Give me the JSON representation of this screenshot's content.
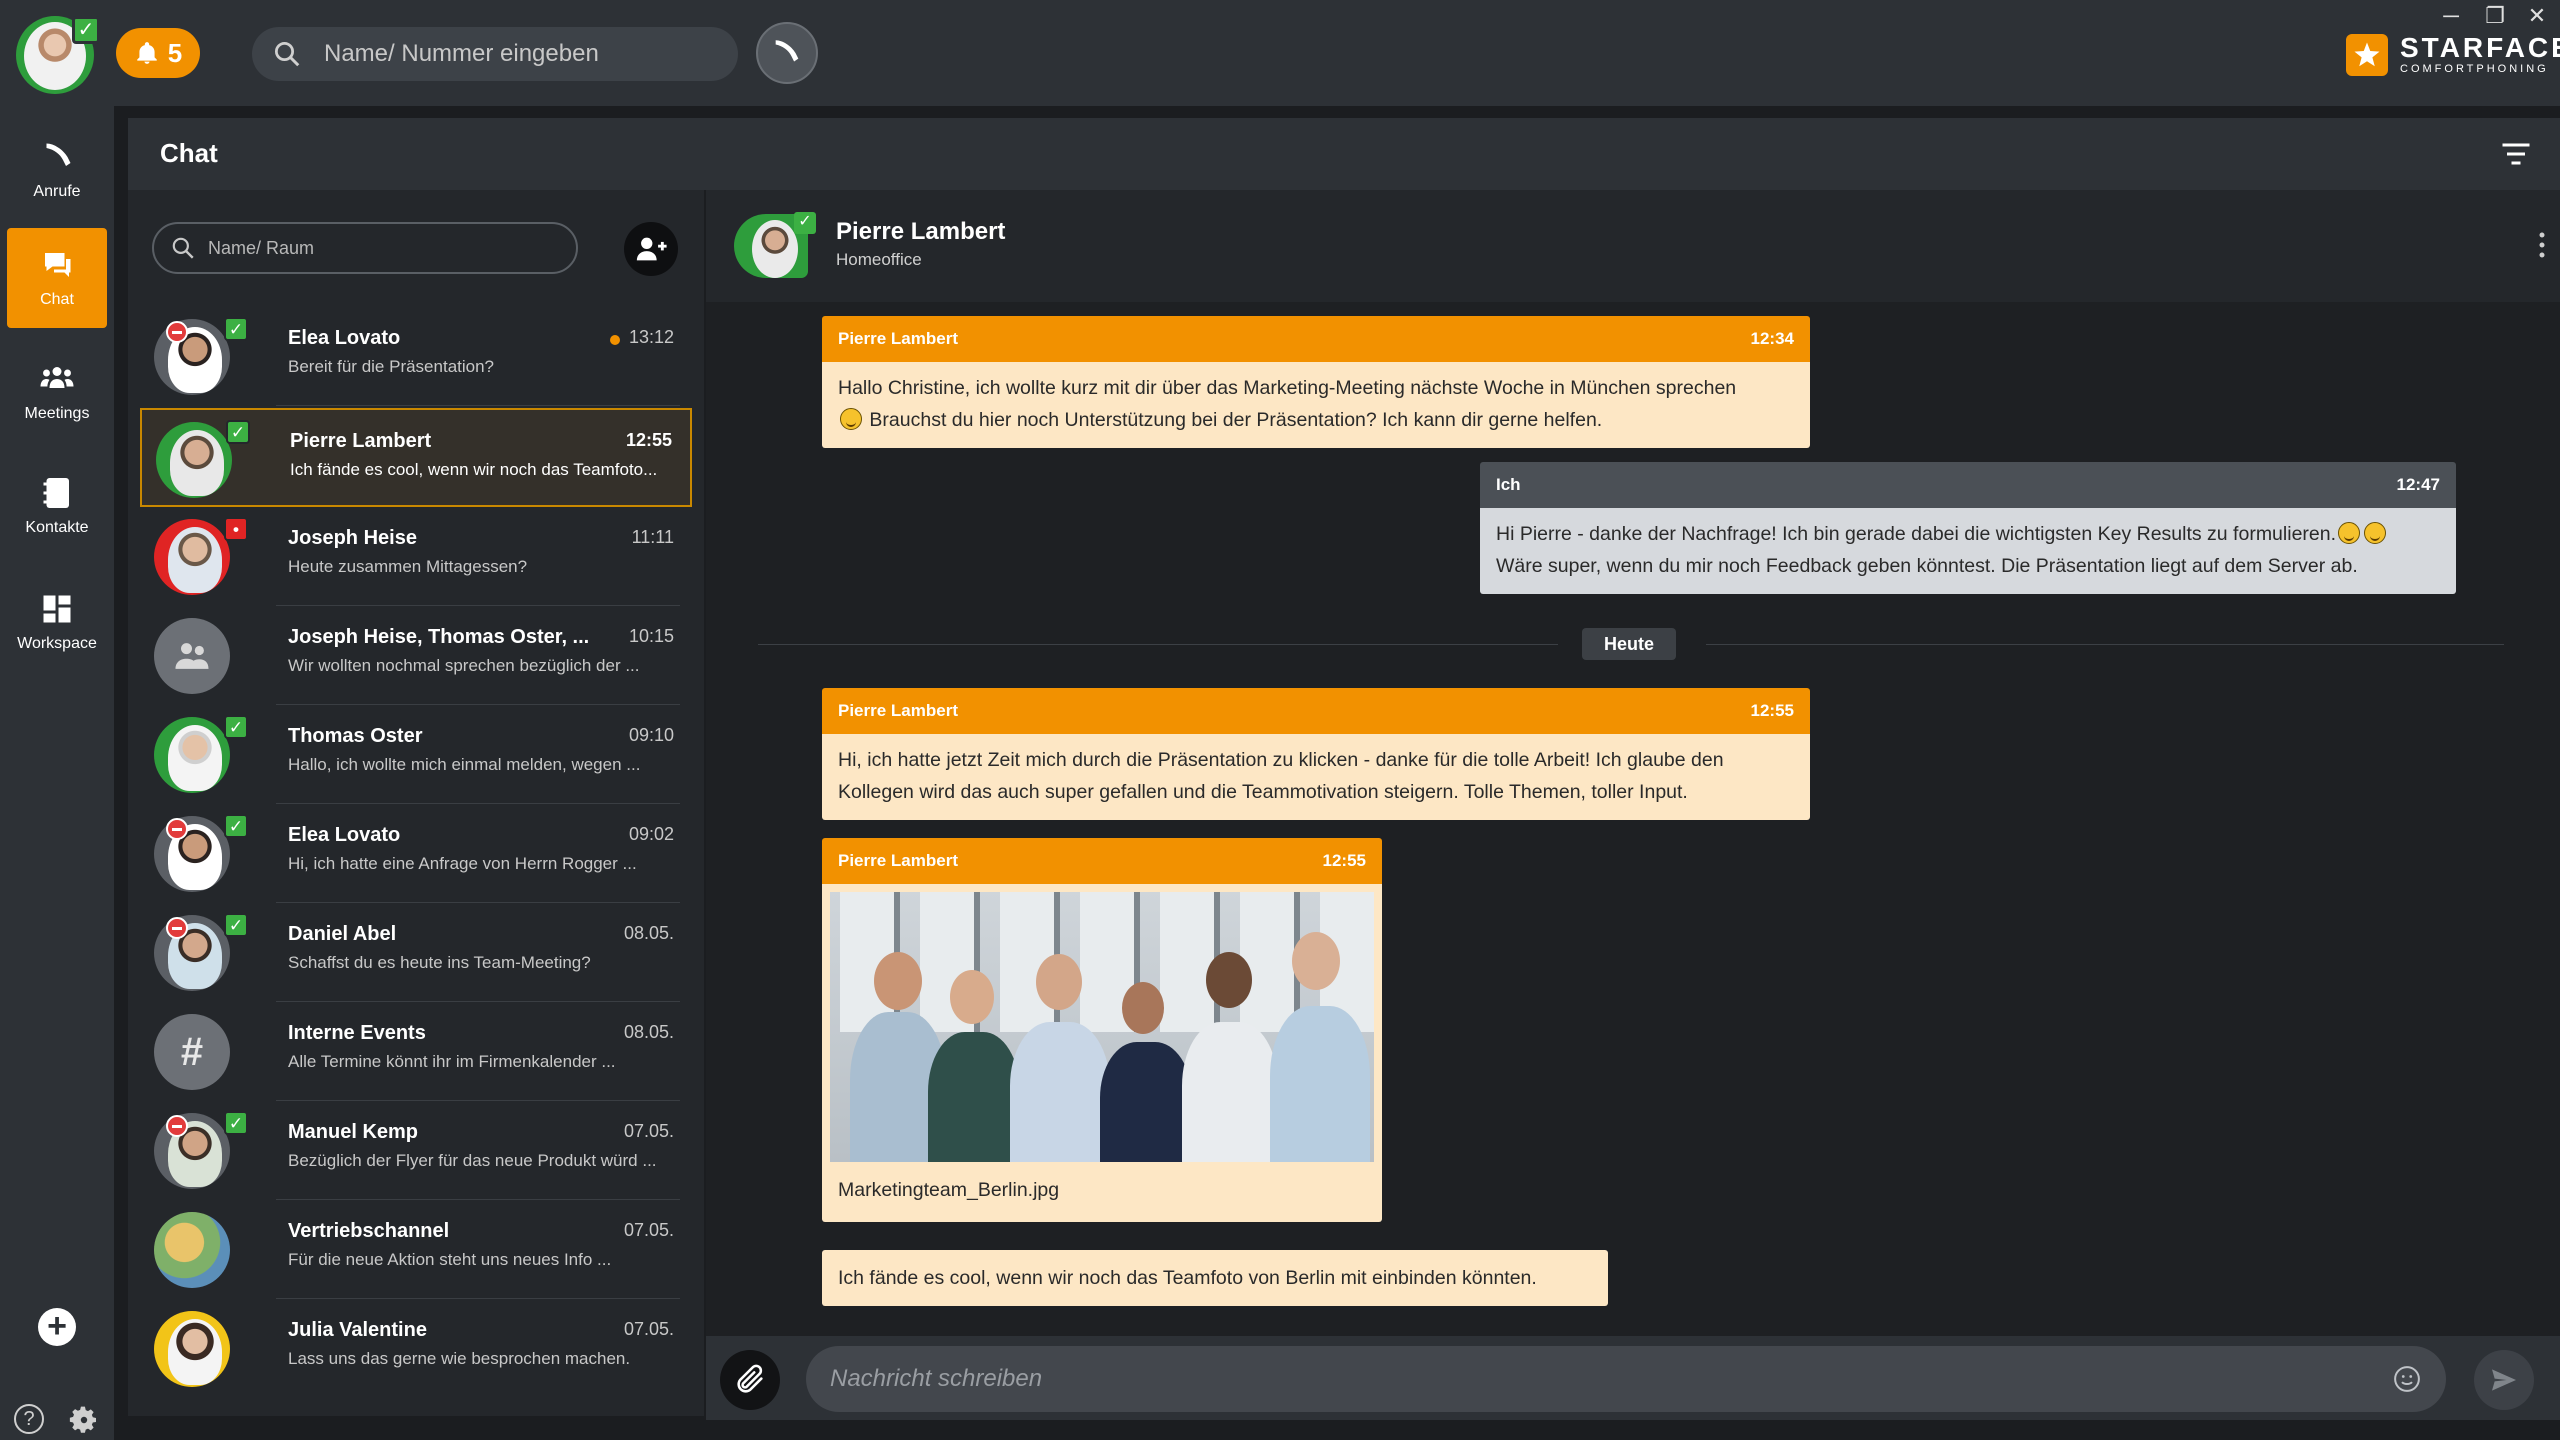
{
  "topbar": {
    "notifications_count": "5",
    "search_placeholder": "Name/ Nummer eingeben",
    "window_controls": [
      "─",
      "❐",
      "✕"
    ],
    "logo_name": "STARFACE",
    "logo_tagline": "COMFORTPHONING"
  },
  "nav": {
    "items": [
      {
        "label": "Anrufe",
        "icon": "phone-icon"
      },
      {
        "label": "Chat",
        "icon": "chat-icon",
        "active": true
      },
      {
        "label": "Meetings",
        "icon": "people-icon"
      },
      {
        "label": "Kontakte",
        "icon": "contacts-icon"
      },
      {
        "label": "Workspace",
        "icon": "workspace-icon"
      }
    ],
    "add_label": "+",
    "help_label": "?"
  },
  "chat_header": {
    "title": "Chat"
  },
  "list": {
    "search_placeholder": "Name/ Raum",
    "conversations": [
      {
        "name": "Elea Lovato",
        "preview": "Bereit für die Präsentation?",
        "time": "13:12",
        "unread": true
      },
      {
        "name": "Pierre Lambert",
        "preview": "Ich fände es cool, wenn wir noch das Teamfoto...",
        "time": "12:55",
        "active": true
      },
      {
        "name": "Joseph Heise",
        "preview": "Heute zusammen Mittagessen?",
        "time": "11:11"
      },
      {
        "name": "Joseph Heise, Thomas Oster, ...",
        "preview": "Wir wollten nochmal sprechen bezüglich der ...",
        "time": "10:15"
      },
      {
        "name": "Thomas Oster",
        "preview": "Hallo, ich wollte mich einmal melden, wegen ...",
        "time": "09:10"
      },
      {
        "name": "Elea Lovato",
        "preview": "Hi, ich hatte eine Anfrage von Herrn Rogger ...",
        "time": "09:02"
      },
      {
        "name": "Daniel Abel",
        "preview": "Schaffst du es heute ins Team-Meeting?",
        "time": "08.05."
      },
      {
        "name": "Interne Events",
        "preview": "Alle Termine könnt ihr im Firmenkalender ...",
        "time": "08.05."
      },
      {
        "name": "Manuel Kemp",
        "preview": "Bezüglich der Flyer für das neue Produkt würd ...",
        "time": "07.05."
      },
      {
        "name": "Vertriebschannel",
        "preview": "Für die neue Aktion steht uns neues Info ...",
        "time": "07.05."
      },
      {
        "name": "Julia Valentine",
        "preview": "Lass uns das gerne wie besprochen machen.",
        "time": "07.05."
      }
    ]
  },
  "contact": {
    "name": "Pierre Lambert",
    "status": "Homeoffice"
  },
  "messages": [
    {
      "sender": "Pierre Lambert",
      "time": "12:34",
      "text1": "Hallo Christine, ich wollte kurz mit dir über das Marketing-Meeting nächste Woche in München sprechen",
      "text2": "Brauchst du hier noch Unterstützung bei der Präsentation? Ich kann dir gerne helfen."
    },
    {
      "sender": "Ich",
      "time": "12:47",
      "text1": "Hi Pierre - danke der Nachfrage! Ich bin gerade dabei die wichtigsten Key Results zu formulieren.",
      "text2": "Wäre super, wenn du mir noch Feedback geben könntest. Die Präsentation liegt auf dem Server ab."
    },
    {
      "sender": "Pierre Lambert",
      "time": "12:55",
      "text1": "Hi, ich hatte jetzt Zeit mich durch die Präsentation zu klicken - danke für die tolle Arbeit! Ich glaube den",
      "text2": "Kollegen wird das auch super gefallen und die Teammotivation steigern. Tolle Themen, toller Input."
    },
    {
      "sender": "Pierre Lambert",
      "time": "12:55",
      "filename": "Marketingteam_Berlin.jpg"
    },
    {
      "text1": "Ich fände es cool, wenn wir noch das Teamfoto von Berlin mit einbinden könnten."
    }
  ],
  "day_separator": "Heute",
  "composer": {
    "placeholder": "Nachricht schreiben"
  },
  "colors": {
    "accent": "#f29100",
    "online": "#3cb043",
    "dnd": "#e23b3b"
  }
}
